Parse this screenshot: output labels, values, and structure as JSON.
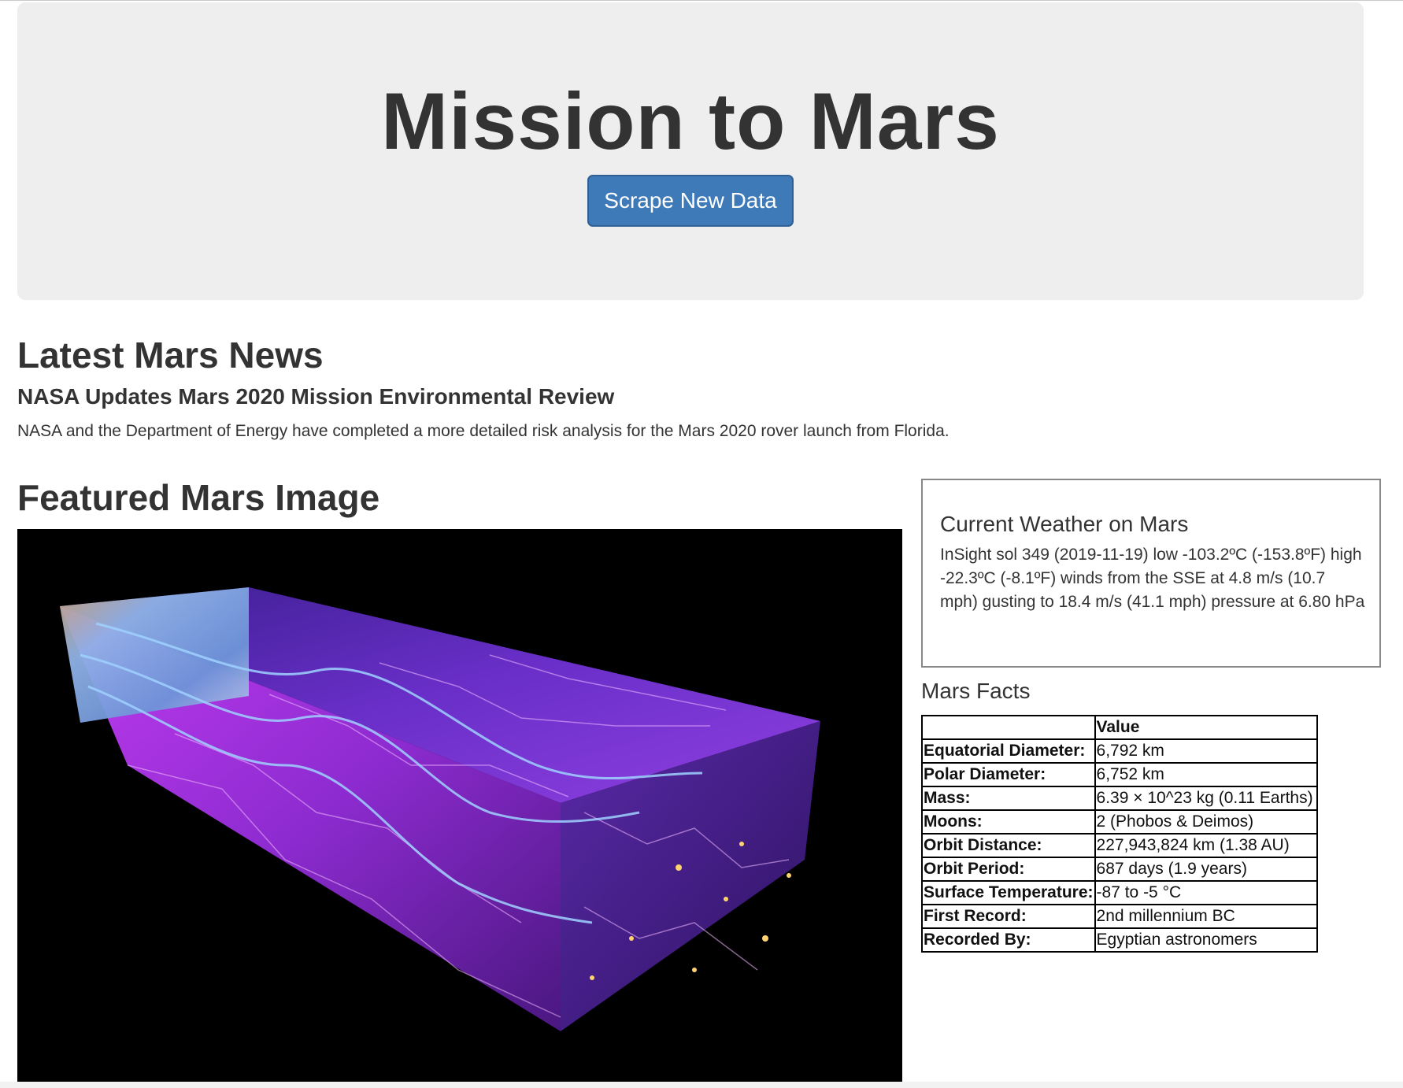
{
  "header": {
    "title": "Mission to Mars",
    "scrape_button": "Scrape New Data"
  },
  "news": {
    "heading": "Latest Mars News",
    "title": "NASA Updates Mars 2020 Mission Environmental Review",
    "paragraph": "NASA and the Department of Energy have completed a more detailed risk analysis for the Mars 2020 rover launch from Florida."
  },
  "featured": {
    "heading": "Featured Mars Image"
  },
  "weather": {
    "heading": "Current Weather on Mars",
    "text": "InSight sol 349 (2019-11-19) low -103.2ºC (-153.8ºF) high -22.3ºC (-8.1ºF) winds from the SSE at 4.8 m/s (10.7 mph) gusting to 18.4 m/s (41.1 mph) pressure at 6.80 hPa"
  },
  "facts": {
    "heading": "Mars Facts",
    "column_header": "Value",
    "rows": [
      {
        "label": "Equatorial Diameter:",
        "value": "6,792 km"
      },
      {
        "label": "Polar Diameter:",
        "value": "6,752 km"
      },
      {
        "label": "Mass:",
        "value": "6.39 × 10^23 kg (0.11 Earths)"
      },
      {
        "label": "Moons:",
        "value": "2 (Phobos & Deimos)"
      },
      {
        "label": "Orbit Distance:",
        "value": "227,943,824 km (1.38 AU)"
      },
      {
        "label": "Orbit Period:",
        "value": "687 days (1.9 years)"
      },
      {
        "label": "Surface Temperature:",
        "value": "-87 to -5 °C"
      },
      {
        "label": "First Record:",
        "value": "2nd millennium BC"
      },
      {
        "label": "Recorded By:",
        "value": "Egyptian astronomers"
      }
    ]
  },
  "colors": {
    "jumbotron_bg": "#eeeeee",
    "button_bg": "#3f7ab8",
    "text": "#333333"
  }
}
